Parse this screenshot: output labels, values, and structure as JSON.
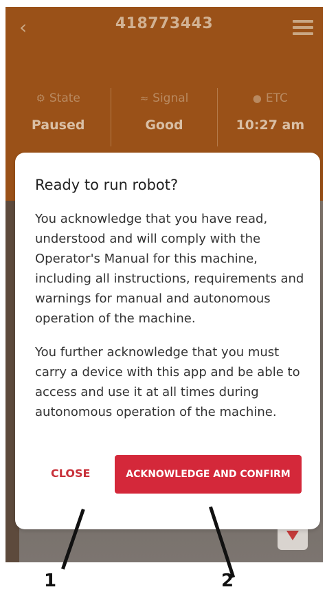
{
  "header": {
    "title": "418773443",
    "back_icon": "chevron-left-icon",
    "menu_icon": "hamburger-menu-icon"
  },
  "stats": [
    {
      "label": "State",
      "value": "Paused",
      "icon": "robot-state-icon"
    },
    {
      "label": "Signal",
      "value": "Good",
      "icon": "wifi-icon"
    },
    {
      "label": "ETC",
      "value": "10:27 am",
      "icon": "clock-icon"
    }
  ],
  "dialog": {
    "title": "Ready to run robot?",
    "paragraph1": "You acknowledge that you have read, understood and will comply with the Operator's Manual for this machine, including all instructions, requirements and warnings for manual and autonomous operation of the machine.",
    "paragraph2": "You further acknowledge that you must carry a device with this app and be able to access and use it at all times during autonomous operation of the machine.",
    "close_label": "CLOSE",
    "confirm_label": "ACKNOWLEDGE AND CONFIRM"
  },
  "callouts": [
    "1",
    "2"
  ],
  "colors": {
    "header": "#9a5118",
    "accent": "#d4283a",
    "close_text": "#c8313a"
  }
}
